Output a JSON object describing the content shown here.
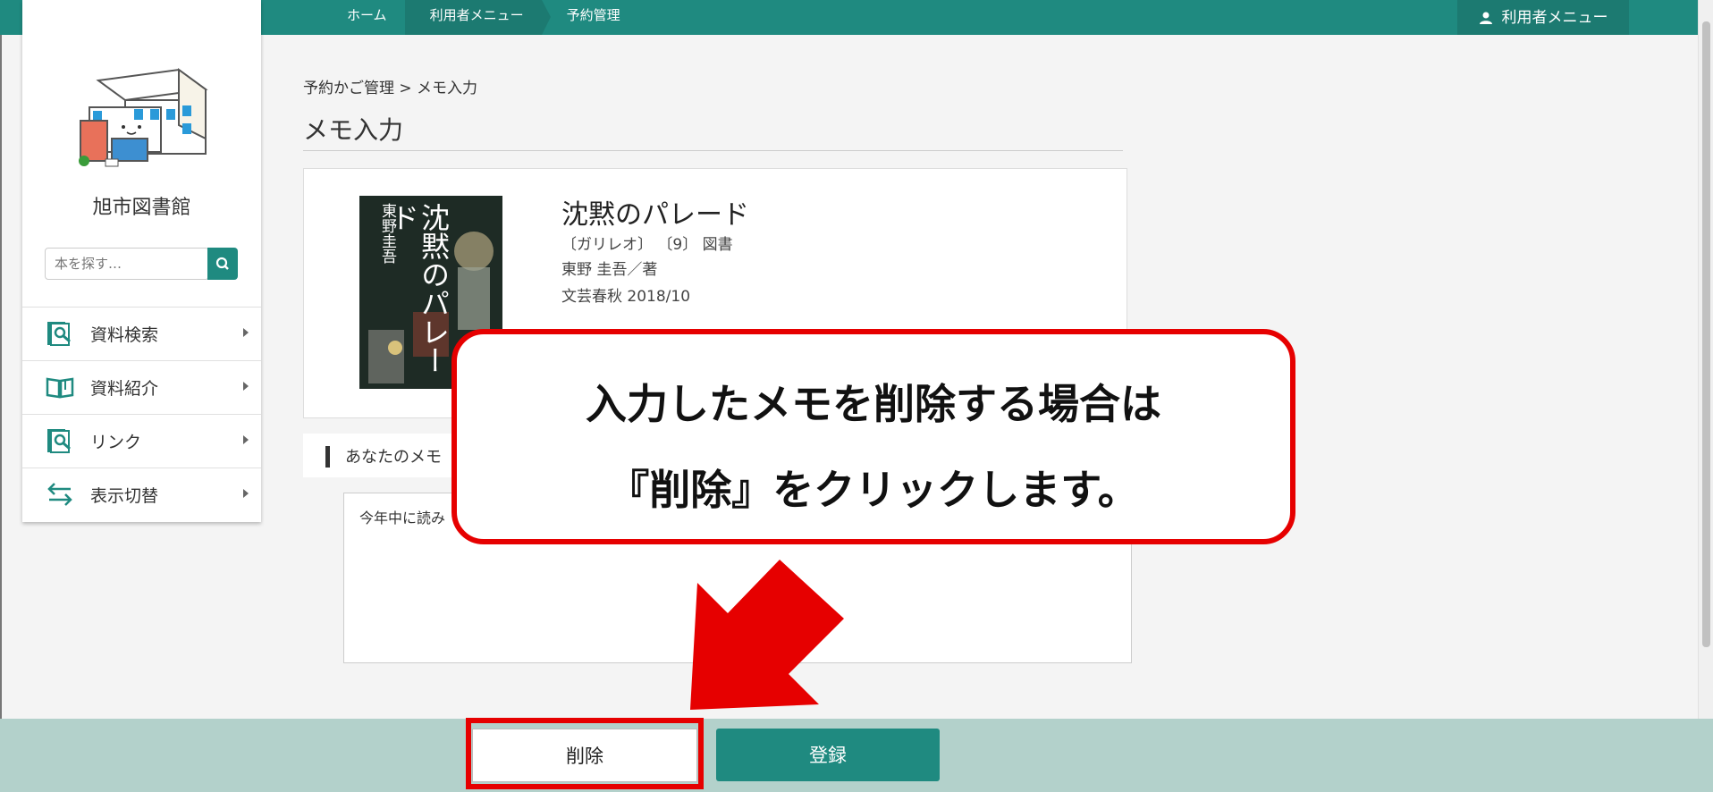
{
  "nav": {
    "home": "ホーム",
    "user_menu": "利用者メニュー",
    "reservation": "予約管理",
    "user_button": "利用者メニュー"
  },
  "sidebar": {
    "library_name": "旭市図書館",
    "search_placeholder": "本を探す…",
    "items": [
      {
        "label": "資料検索",
        "icon": "search-doc-icon"
      },
      {
        "label": "資料紹介",
        "icon": "open-book-icon"
      },
      {
        "label": "リンク",
        "icon": "link-search-icon"
      },
      {
        "label": "表示切替",
        "icon": "swap-arrows-icon"
      }
    ]
  },
  "main": {
    "breadcrumb": "予約かご管理 > メモ入力",
    "title": "メモ入力",
    "book": {
      "title": "沈黙のパレード",
      "series": "〔ガリレオ〕 〔9〕 図書",
      "author": "東野 圭吾／著",
      "publisher": "文芸春秋  2018/10",
      "cover_title": "沈黙のパレード",
      "cover_author": "東野圭吾"
    },
    "memo_label": "あなたのメモ",
    "memo_text": "今年中に読み"
  },
  "footer": {
    "delete_label": "削除",
    "register_label": "登録"
  },
  "callout": {
    "line1": "入力したメモを削除する場合は",
    "line2": "『削除』をクリックします。"
  },
  "colors": {
    "brand": "#1f8a80",
    "highlight": "#e60000",
    "footer": "#b3d1cb"
  }
}
